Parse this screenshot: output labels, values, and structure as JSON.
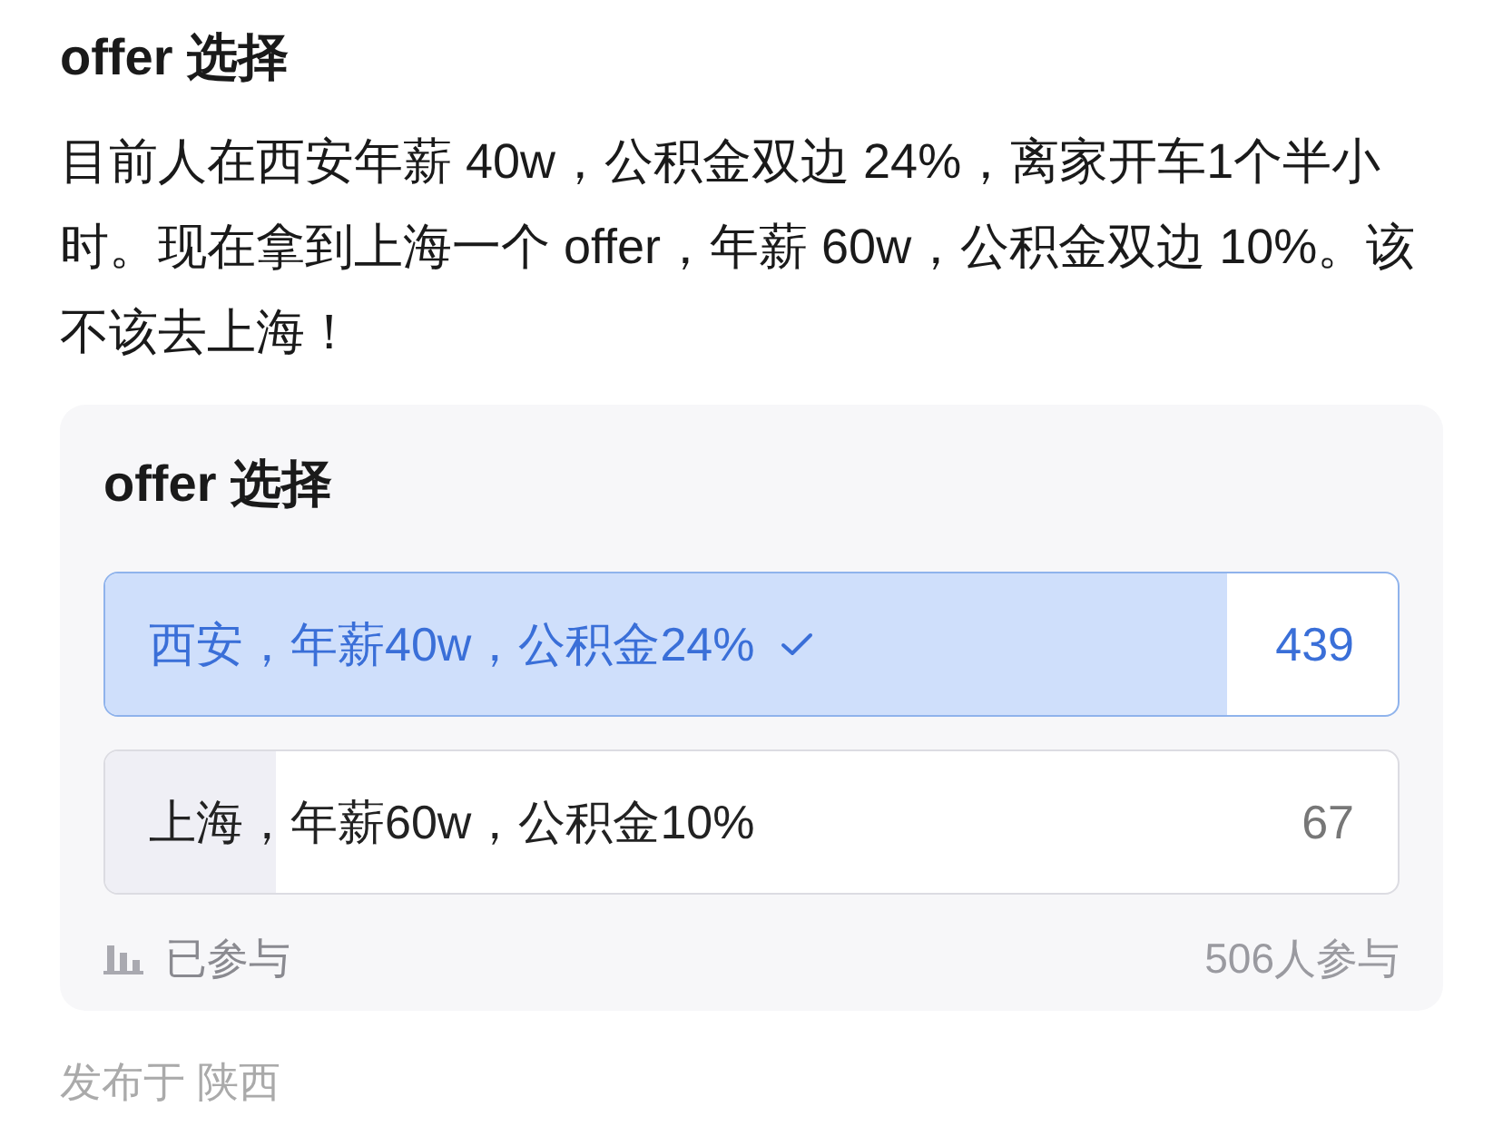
{
  "post": {
    "title": "offer 选择",
    "body": "目前人在西安年薪 40w，公积金双边 24%，离家开车1个半小时。现在拿到上海一个 offer，年薪 60w，公积金双边 10%。该不该去上海！"
  },
  "poll": {
    "title": "offer 选择",
    "options": [
      {
        "label": "西安，年薪40w，公积金24%",
        "count": "439",
        "selected": true,
        "level": 0.868
      },
      {
        "label": "上海，年薪60w，公积金10%",
        "count": "67",
        "selected": false,
        "level": 0.132
      }
    ],
    "status": "已参与",
    "total": "506人参与"
  },
  "location": "发布于 陕西"
}
